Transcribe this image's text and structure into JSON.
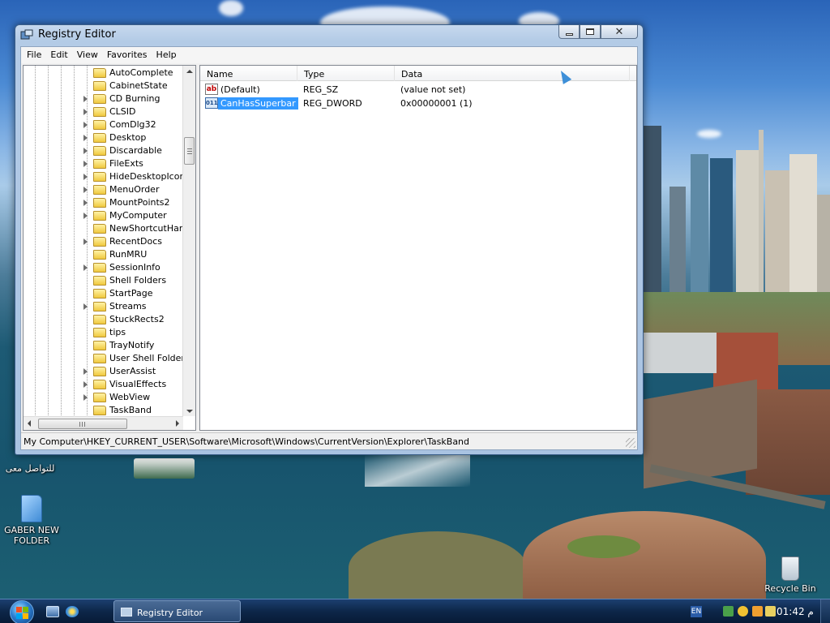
{
  "window": {
    "title": "Registry Editor",
    "menu": [
      "File",
      "Edit",
      "View",
      "Favorites",
      "Help"
    ]
  },
  "tree": {
    "items": [
      {
        "label": "AutoComplete",
        "expandable": false
      },
      {
        "label": "CabinetState",
        "expandable": false
      },
      {
        "label": "CD Burning",
        "expandable": true
      },
      {
        "label": "CLSID",
        "expandable": true
      },
      {
        "label": "ComDlg32",
        "expandable": true
      },
      {
        "label": "Desktop",
        "expandable": true
      },
      {
        "label": "Discardable",
        "expandable": true
      },
      {
        "label": "FileExts",
        "expandable": true
      },
      {
        "label": "HideDesktopIcons",
        "expandable": true
      },
      {
        "label": "MenuOrder",
        "expandable": true
      },
      {
        "label": "MountPoints2",
        "expandable": true
      },
      {
        "label": "MyComputer",
        "expandable": true
      },
      {
        "label": "NewShortcutHandl",
        "expandable": false
      },
      {
        "label": "RecentDocs",
        "expandable": true
      },
      {
        "label": "RunMRU",
        "expandable": false
      },
      {
        "label": "SessionInfo",
        "expandable": true
      },
      {
        "label": "Shell Folders",
        "expandable": false
      },
      {
        "label": "StartPage",
        "expandable": false
      },
      {
        "label": "Streams",
        "expandable": true
      },
      {
        "label": "StuckRects2",
        "expandable": false
      },
      {
        "label": "tips",
        "expandable": false
      },
      {
        "label": "TrayNotify",
        "expandable": false
      },
      {
        "label": "User Shell Folders",
        "expandable": false
      },
      {
        "label": "UserAssist",
        "expandable": true
      },
      {
        "label": "VisualEffects",
        "expandable": true
      },
      {
        "label": "WebView",
        "expandable": true
      },
      {
        "label": "TaskBand",
        "expandable": false
      }
    ]
  },
  "list": {
    "columns": [
      "Name",
      "Type",
      "Data"
    ],
    "rows": [
      {
        "name": "(Default)",
        "type": "REG_SZ",
        "data": "(value not set)",
        "icon": "string-value-icon",
        "selected": false
      },
      {
        "name": "CanHasSuperbar",
        "type": "REG_DWORD",
        "data": "0x00000001 (1)",
        "icon": "binary-value-icon",
        "selected": true
      }
    ]
  },
  "status": {
    "path": "My Computer\\HKEY_CURRENT_USER\\Software\\Microsoft\\Windows\\CurrentVersion\\Explorer\\TaskBand"
  },
  "desktop": {
    "icons": [
      {
        "label": "GABER NEW FOLDER",
        "icon": "folder-icon"
      },
      {
        "label": "Recycle Bin",
        "icon": "recycle-bin-icon"
      },
      {
        "label": "للتواصل معى",
        "icon": "shortcut-icon"
      }
    ]
  },
  "taskbar": {
    "task_label": "Registry Editor",
    "lang": "EN",
    "clock": "01:42 م"
  }
}
